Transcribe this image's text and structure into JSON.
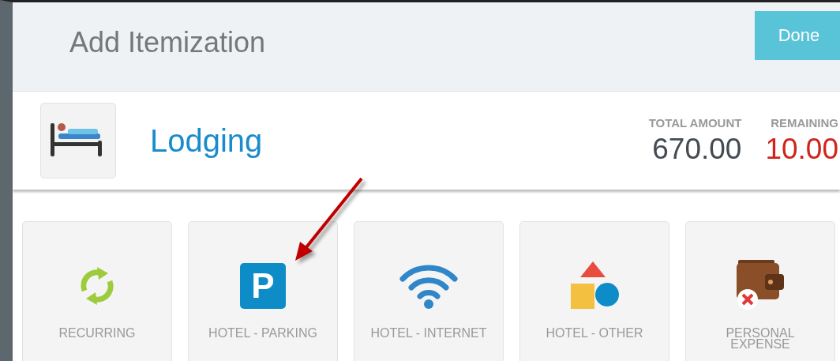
{
  "header": {
    "title": "Add Itemization",
    "done_button": "Done"
  },
  "expense": {
    "type": "Lodging",
    "totals": [
      {
        "label": "TOTAL AMOUNT",
        "value": "670.00",
        "kind": "total"
      },
      {
        "label": "REMAINING",
        "value": "10.00",
        "kind": "remaining"
      }
    ]
  },
  "tiles": [
    {
      "label": "RECURRING",
      "kind": "recurring"
    },
    {
      "label": "HOTEL - PARKING",
      "kind": "parking",
      "glyph": "P"
    },
    {
      "label": "HOTEL - INTERNET",
      "kind": "internet"
    },
    {
      "label": "HOTEL - OTHER",
      "kind": "other"
    },
    {
      "label": "PERSONAL EXPENSE",
      "kind": "personal"
    }
  ]
}
